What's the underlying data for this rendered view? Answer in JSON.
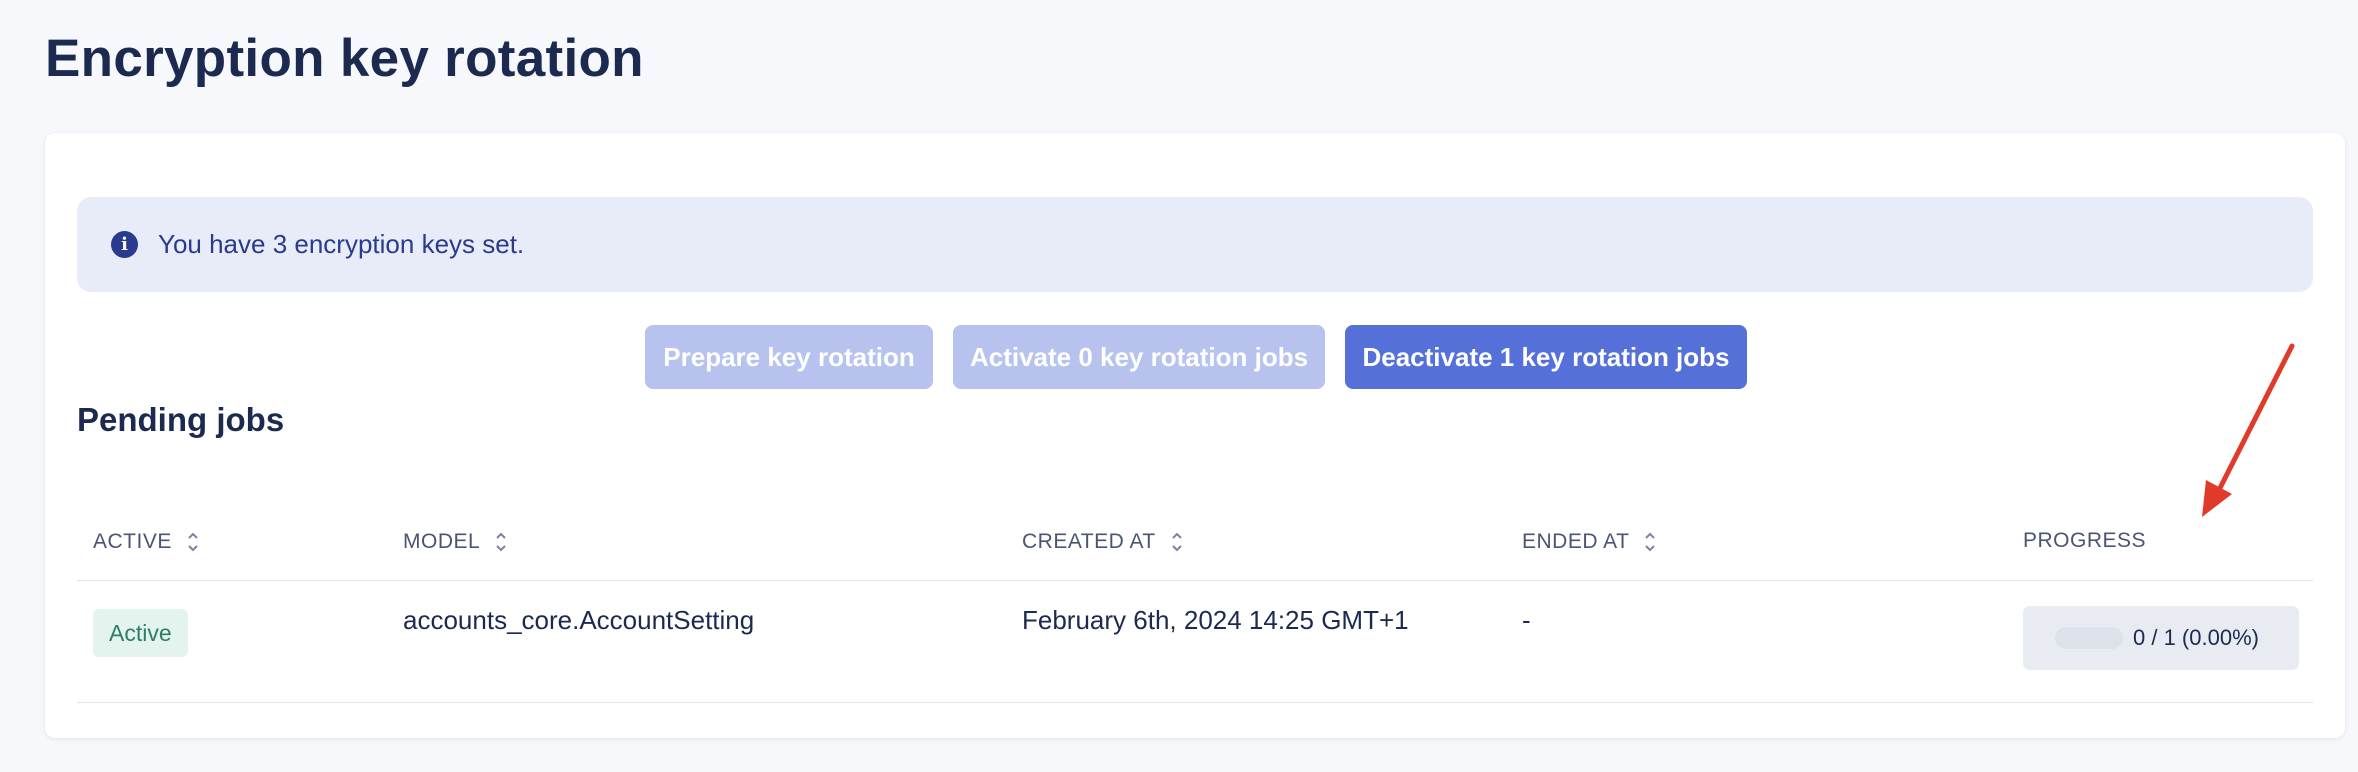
{
  "page": {
    "title": "Encryption key rotation"
  },
  "alert": {
    "icon": "info-icon",
    "text": "You have 3 encryption keys set."
  },
  "actions": {
    "prepare_label": "Prepare key rotation",
    "activate_label": "Activate 0 key rotation jobs",
    "deactivate_label": "Deactivate 1 key rotation jobs"
  },
  "pending": {
    "title": "Pending jobs",
    "columns": [
      {
        "label": "ACTIVE",
        "sortable": true
      },
      {
        "label": "MODEL",
        "sortable": true
      },
      {
        "label": "CREATED AT",
        "sortable": true
      },
      {
        "label": "ENDED AT",
        "sortable": true
      },
      {
        "label": "PROGRESS",
        "sortable": false
      }
    ],
    "rows": [
      {
        "active": "Active",
        "model": "accounts_core.AccountSetting",
        "created_at": "February 6th, 2024 14:25 GMT+1",
        "ended_at": "-",
        "progress_text": "0 / 1 (0.00%)",
        "progress_fraction": 0
      }
    ]
  },
  "colors": {
    "primary": "#5570d8",
    "primary_disabled": "#b7c3ee",
    "alert_bg": "#e8ecf8",
    "alert_text": "#2a3a8f",
    "badge_bg": "#e3f4ef",
    "badge_text": "#2f7d68",
    "annotation_arrow": "#e03b2a"
  }
}
